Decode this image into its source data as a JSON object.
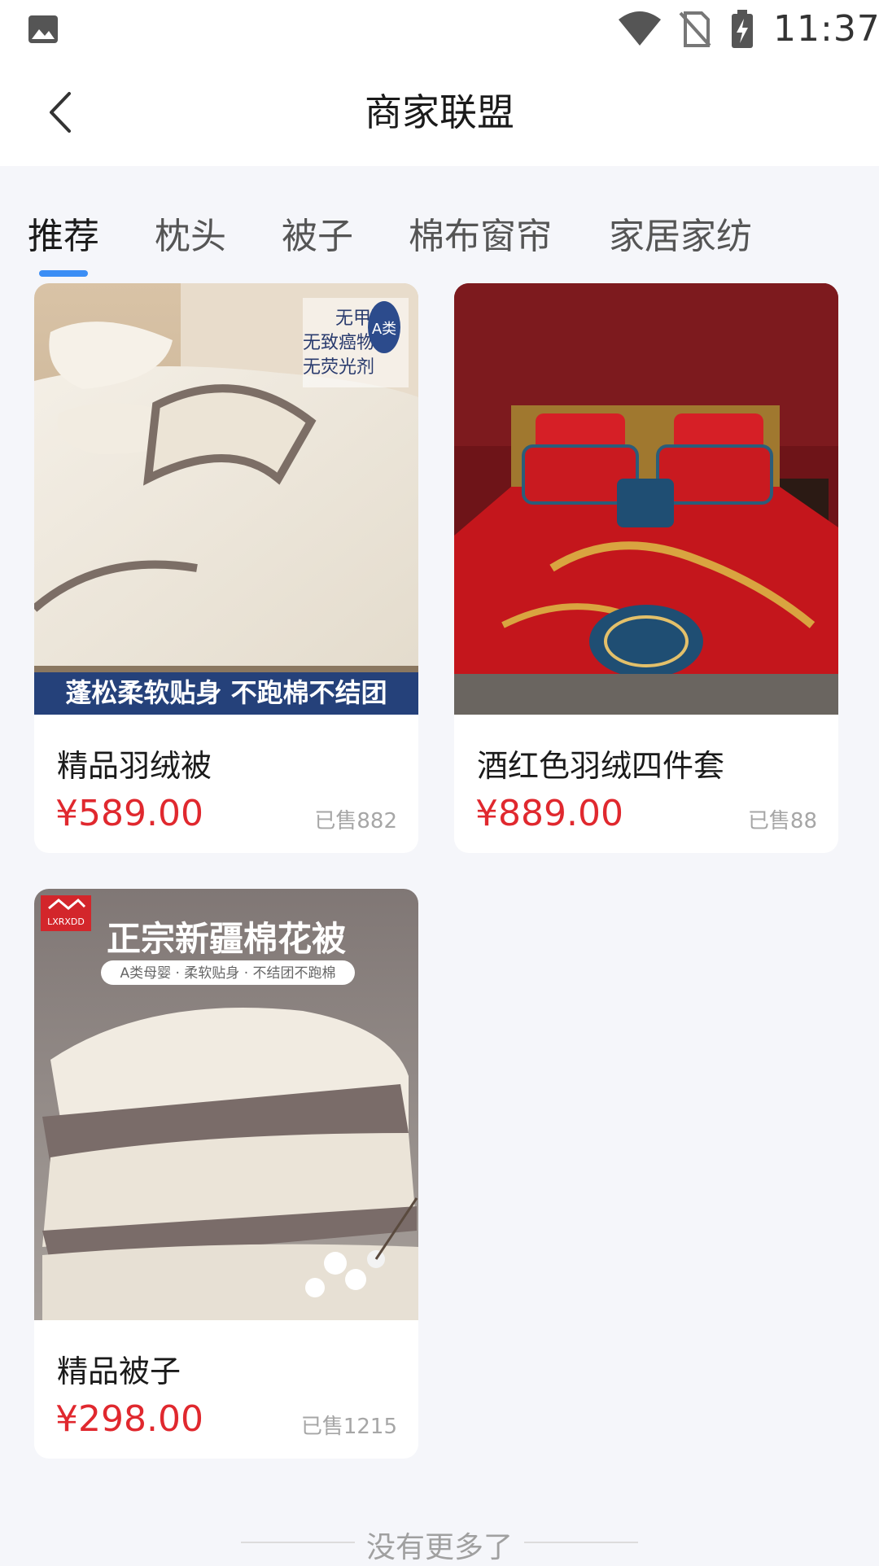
{
  "status": {
    "time": "11:37",
    "icons": [
      "gallery-icon",
      "wifi-icon",
      "no-sim-icon",
      "battery-charging-icon"
    ]
  },
  "header": {
    "title": "商家联盟",
    "back_icon": "chevron-left-icon"
  },
  "tabs": [
    {
      "label": "推荐",
      "active": true
    },
    {
      "label": "枕头",
      "active": false
    },
    {
      "label": "被子",
      "active": false
    },
    {
      "label": "棉布窗帘",
      "active": false
    },
    {
      "label": "家居家纺",
      "active": false
    }
  ],
  "products": [
    {
      "name": "精品羽绒被",
      "price": "¥589.00",
      "sold": "已售882",
      "image": {
        "banner": "蓬松柔软贴身 不跑棉不结团",
        "tag_lines": [
          "无甲醛",
          "无致癌物",
          "无荧光剂"
        ],
        "badge": "A类"
      }
    },
    {
      "name": "酒红色羽绒四件套",
      "price": "¥889.00",
      "sold": "已售88"
    },
    {
      "name": "精品被子",
      "price": "¥298.00",
      "sold": "已售1215",
      "image": {
        "logo": "LXRXDD",
        "headline": "正宗新疆棉花被",
        "subline": "A类母婴 · 柔软贴身 · 不结团不跑棉"
      }
    }
  ],
  "footer": {
    "end_text": "没有更多了"
  },
  "colors": {
    "accent": "#3b8ef5",
    "price": "#e0282e"
  }
}
